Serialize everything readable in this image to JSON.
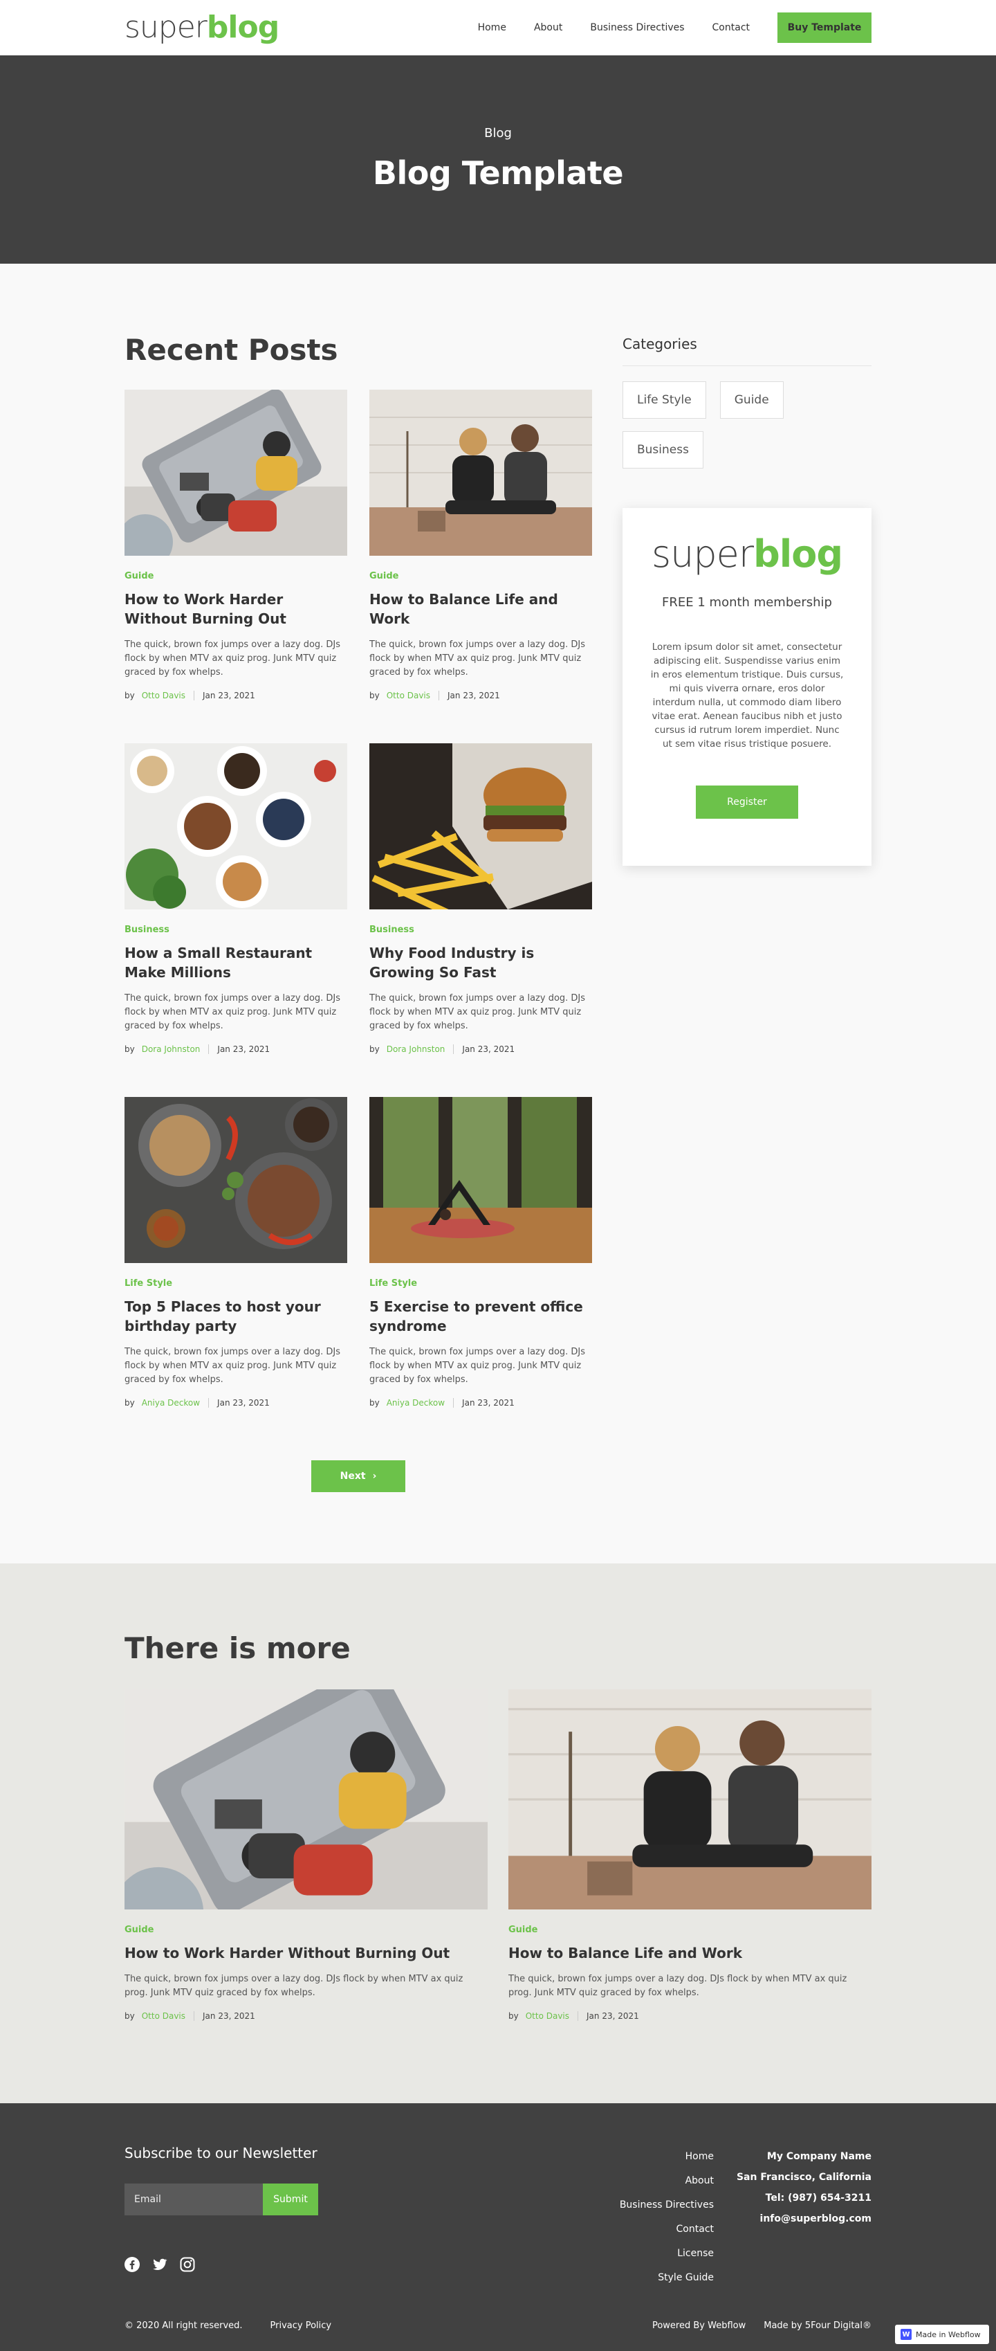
{
  "nav": {
    "logo_light": "super",
    "logo_bold": "blog",
    "links": [
      "Home",
      "About",
      "Business Directives",
      "Contact"
    ],
    "cta": "Buy Template"
  },
  "hero": {
    "eyebrow": "Blog",
    "title": "Blog Template"
  },
  "recent": {
    "title": "Recent Posts",
    "posts": [
      {
        "category": "Guide",
        "title": "How to Work Harder Without Burning Out",
        "excerpt": "The quick, brown fox jumps over a lazy dog. DJs flock by when MTV ax quiz prog. Junk MTV quiz graced by fox whelps.",
        "by": "by",
        "author": "Otto Davis",
        "date": "Jan 23, 2021"
      },
      {
        "category": "Guide",
        "title": "How to Balance Life and Work",
        "excerpt": "The quick, brown fox jumps over a lazy dog. DJs flock by when MTV ax quiz prog. Junk MTV quiz graced by fox whelps.",
        "by": "by",
        "author": "Otto Davis",
        "date": "Jan 23, 2021"
      },
      {
        "category": "Business",
        "title": "How a Small Restaurant Make Millions",
        "excerpt": "The quick, brown fox jumps over a lazy dog. DJs flock by when MTV ax quiz prog. Junk MTV quiz graced by fox whelps.",
        "by": "by",
        "author": "Dora Johnston",
        "date": "Jan 23, 2021"
      },
      {
        "category": "Business",
        "title": "Why Food Industry is Growing So Fast",
        "excerpt": "The quick, brown fox jumps over a lazy dog. DJs flock by when MTV ax quiz prog. Junk MTV quiz graced by fox whelps.",
        "by": "by",
        "author": "Dora Johnston",
        "date": "Jan 23, 2021"
      },
      {
        "category": "Life Style",
        "title": "Top 5 Places to host your birthday party",
        "excerpt": "The quick, brown fox jumps over a lazy dog. DJs flock by when MTV ax quiz prog. Junk MTV quiz graced by fox whelps.",
        "by": "by",
        "author": "Aniya Deckow",
        "date": "Jan 23, 2021"
      },
      {
        "category": "Life Style",
        "title": "5 Exercise to prevent office syndrome",
        "excerpt": "The quick, brown fox jumps over a lazy dog. DJs flock by when MTV ax quiz prog. Junk MTV quiz graced by fox whelps.",
        "by": "by",
        "author": "Aniya Deckow",
        "date": "Jan 23, 2021"
      }
    ],
    "next_label": "Next",
    "next_icon": "chevron-right-icon"
  },
  "sidebar": {
    "categories_title": "Categories",
    "tags": [
      "Life Style",
      "Guide",
      "Business"
    ],
    "promo": {
      "logo_light": "super",
      "logo_bold": "blog",
      "tagline": "FREE 1 month membership",
      "description": "Lorem ipsum dolor sit amet, consectetur adipiscing elit. Suspendisse varius enim in eros elementum tristique. Duis cursus, mi quis viverra ornare, eros dolor interdum nulla, ut commodo diam libero vitae erat. Aenean faucibus nibh et justo cursus id rutrum lorem imperdiet. Nunc ut sem vitae risus tristique posuere.",
      "button": "Register"
    }
  },
  "more": {
    "title": "There is more",
    "posts": [
      {
        "category": "Guide",
        "title": "How to Work Harder Without Burning Out",
        "excerpt": "The quick, brown fox jumps over a lazy dog. DJs flock by when MTV ax quiz prog. Junk MTV quiz graced by fox whelps.",
        "by": "by",
        "author": "Otto Davis",
        "date": "Jan 23, 2021"
      },
      {
        "category": "Guide",
        "title": "How to Balance Life and Work",
        "excerpt": "The quick, brown fox jumps over a lazy dog. DJs flock by when MTV ax quiz prog. Junk MTV quiz graced by fox whelps.",
        "by": "by",
        "author": "Otto Davis",
        "date": "Jan 23, 2021"
      }
    ]
  },
  "footer": {
    "newsletter_title": "Subscribe to our Newsletter",
    "email_placeholder": "Email",
    "submit": "Submit",
    "social_icons": [
      "facebook-icon",
      "twitter-icon",
      "instagram-icon"
    ],
    "links": [
      "Home",
      "About",
      "Business Directives",
      "Contact",
      "License",
      "Style Guide"
    ],
    "contact": {
      "company": "My Company Name",
      "city": "San Francisco, California",
      "tel": "Tel: (987) 654-3211",
      "email": "info@superblog.com"
    },
    "copyright": "© 2020 All right reserved.",
    "privacy": "Privacy Policy",
    "powered": "Powered By Webflow",
    "made_by": "Made by 5Four Digital®",
    "badge": "Made in Webflow"
  },
  "colors": {
    "accent": "#6cc24a",
    "dark": "#414141",
    "light_bg": "#f9f9f9",
    "more_bg": "#e8e8e4"
  }
}
